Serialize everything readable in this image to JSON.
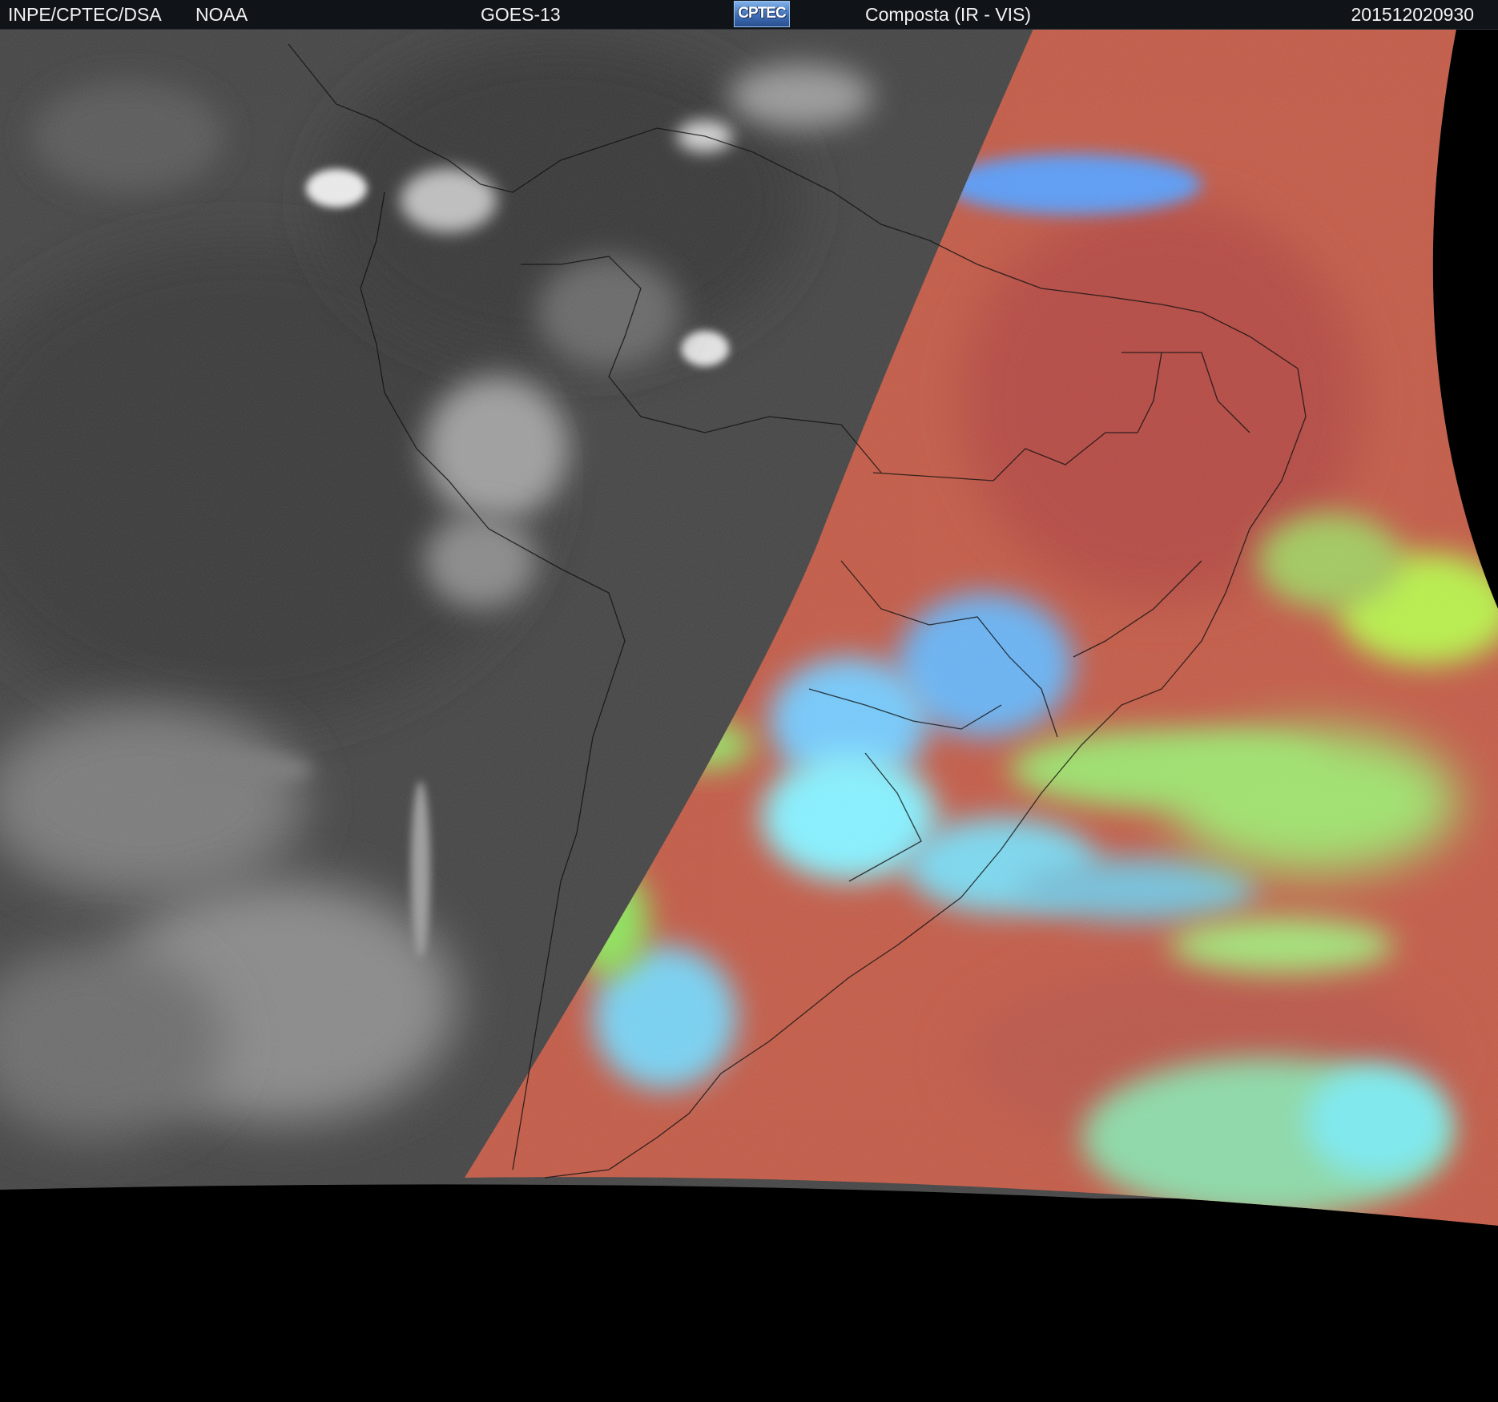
{
  "header": {
    "agency": "INPE/CPTEC/DSA",
    "source": "NOAA",
    "satellite": "GOES-13",
    "logo_text": "CPTEC",
    "product": "Composta (IR - VIS)",
    "timestamp": "201512020930"
  },
  "colors": {
    "header_bg": "#101418",
    "night_ir": "#454545",
    "day_land": "#b8584a",
    "day_ocean": "#c4624c",
    "cloud_blue": "#6ab4f0",
    "cloud_cyan": "#7ee8f8",
    "cloud_green": "#9ee070",
    "space": "#000000"
  }
}
